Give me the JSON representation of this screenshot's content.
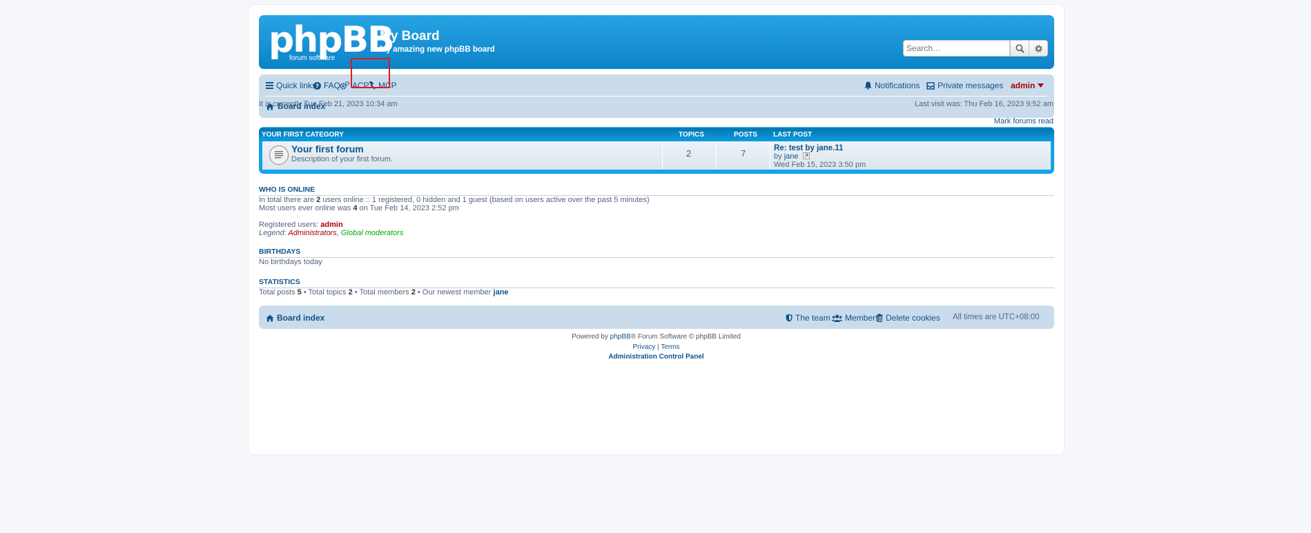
{
  "header": {
    "logo_main": "phpBB",
    "logo_sub": "forum     software",
    "site_title": "My Board",
    "site_desc": "My amazing new phpBB board",
    "search_placeholder": "Search…"
  },
  "nav": {
    "quick_links": "Quick links",
    "faq": "FAQ",
    "acp": "ACP",
    "mcp": "MCP",
    "notifications": "Notifications",
    "private_messages": "Private messages",
    "user": "admin",
    "breadcrumb": "Board index"
  },
  "info": {
    "current_time": "It is currently Tue Feb 21, 2023 10:34 am",
    "last_visit": "Last visit was: Thu Feb 16, 2023 9:52 am",
    "mark_read": "Mark forums read"
  },
  "category": {
    "name": "YOUR FIRST CATEGORY",
    "col_topics": "TOPICS",
    "col_posts": "POSTS",
    "col_last_post": "LAST POST",
    "forum": {
      "title": "Your first forum",
      "desc": "Description of your first forum.",
      "topics": "2",
      "posts": "7",
      "last_post_title": "Re: test by jane.11",
      "last_post_by_prefix": "by ",
      "last_post_author": "jane",
      "last_post_date": "Wed Feb 15, 2023 3:50 pm"
    }
  },
  "who_is_online": {
    "heading": "WHO IS ONLINE",
    "line1_a": "In total there are ",
    "line1_num": "2",
    "line1_b": " users online :: 1 registered, 0 hidden and 1 guest (based on users active over the past 5 minutes)",
    "line2_a": "Most users ever online was ",
    "line2_num": "4",
    "line2_b": " on Tue Feb 14, 2023 2:52 pm",
    "registered_label": "Registered users: ",
    "registered_user": "admin",
    "legend_label": "Legend: ",
    "legend_admins": "Administrators",
    "legend_sep": ", ",
    "legend_gm": "Global moderators"
  },
  "birthdays": {
    "heading": "BIRTHDAYS",
    "text": "No birthdays today"
  },
  "statistics": {
    "heading": "STATISTICS",
    "t1": "Total posts ",
    "n1": "5",
    "t2": " • Total topics ",
    "n2": "2",
    "t3": " • Total members ",
    "n3": "2",
    "t4": " • Our newest member ",
    "newest": "jane"
  },
  "footer": {
    "breadcrumb": "Board index",
    "team": "The team",
    "members": "Members",
    "delete_cookies": "Delete cookies",
    "timezone": "All times are UTC+08:00",
    "powered_a": "Powered by ",
    "powered_link": "phpBB",
    "powered_b": "® Forum Software © phpBB Limited",
    "privacy": "Privacy",
    "sep": " | ",
    "terms": "Terms",
    "acp_link": "Administration Control Panel"
  },
  "colors": {
    "header_blue": "#12a3eb",
    "nav_bg": "#cadceb",
    "link": "#105289",
    "admin_red": "#aa0000",
    "highlight_red": "#e8141c"
  }
}
